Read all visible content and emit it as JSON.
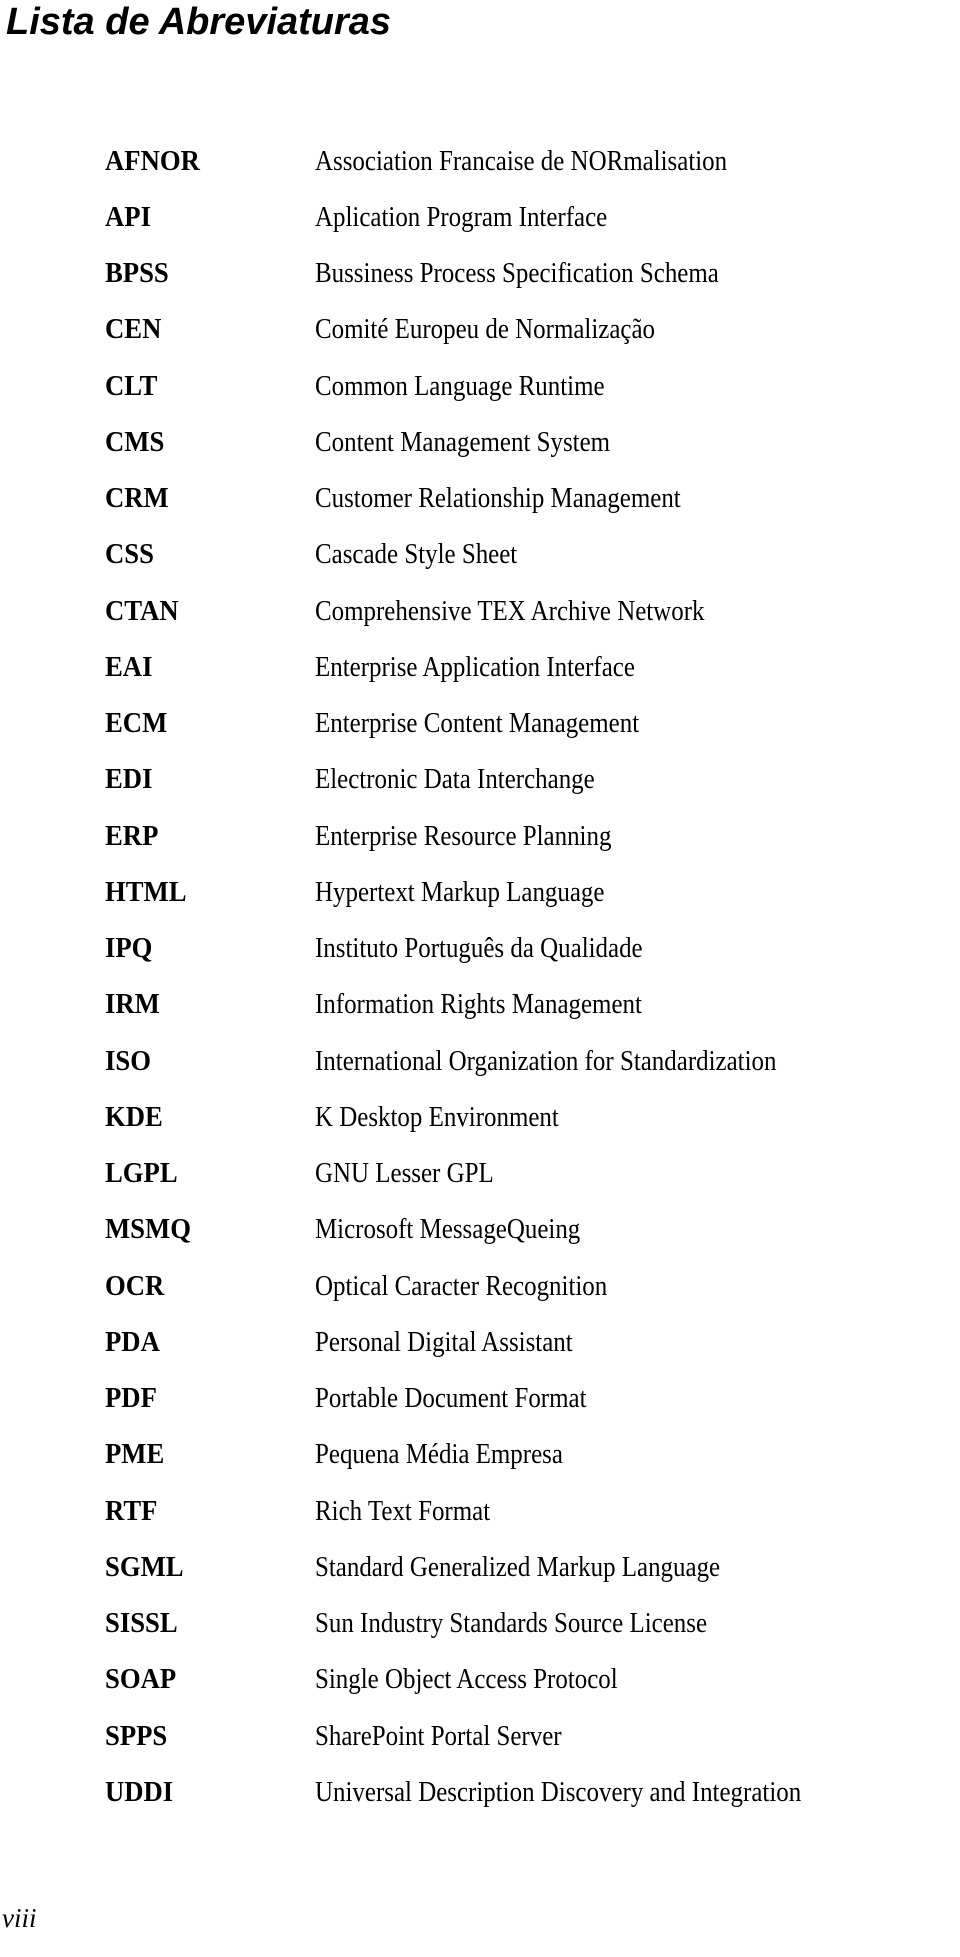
{
  "document": {
    "title": "Lista de Abreviaturas",
    "page_number": "viii",
    "abbreviations": [
      {
        "term": "AFNOR",
        "description": "Association Francaise de NORmalisation"
      },
      {
        "term": "API",
        "description": "Aplication Program Interface"
      },
      {
        "term": "BPSS",
        "description": "Bussiness Process Specification Schema"
      },
      {
        "term": "CEN",
        "description": "Comité Europeu de Normalização"
      },
      {
        "term": "CLT",
        "description": "Common Language Runtime"
      },
      {
        "term": "CMS",
        "description": "Content Management System"
      },
      {
        "term": "CRM",
        "description": "Customer Relationship Management"
      },
      {
        "term": "CSS",
        "description": "Cascade Style Sheet"
      },
      {
        "term": "CTAN",
        "description": "Comprehensive TEX Archive Network"
      },
      {
        "term": "EAI",
        "description": "Enterprise Application Interface"
      },
      {
        "term": "ECM",
        "description": "Enterprise Content Management"
      },
      {
        "term": "EDI",
        "description": "Electronic Data Interchange"
      },
      {
        "term": "ERP",
        "description": "Enterprise Resource Planning"
      },
      {
        "term": "HTML",
        "description": "Hypertext Markup Language"
      },
      {
        "term": "IPQ",
        "description": "Instituto Português da Qualidade"
      },
      {
        "term": "IRM",
        "description": "Information Rights Management"
      },
      {
        "term": "ISO",
        "description": "International Organization for Standardization"
      },
      {
        "term": "KDE",
        "description": "K Desktop Environment"
      },
      {
        "term": "LGPL",
        "description": "GNU Lesser GPL"
      },
      {
        "term": "MSMQ",
        "description": "Microsoft MessageQueing"
      },
      {
        "term": "OCR",
        "description": "Optical Caracter Recognition"
      },
      {
        "term": "PDA",
        "description": "Personal Digital Assistant"
      },
      {
        "term": "PDF",
        "description": "Portable Document Format"
      },
      {
        "term": "PME",
        "description": "Pequena Média Empresa"
      },
      {
        "term": "RTF",
        "description": "Rich Text Format"
      },
      {
        "term": "SGML",
        "description": "Standard Generalized Markup Language"
      },
      {
        "term": "SISSL",
        "description": "Sun Industry Standards Source License"
      },
      {
        "term": "SOAP",
        "description": "Single Object Access Protocol"
      },
      {
        "term": "SPPS",
        "description": "SharePoint Portal Server"
      },
      {
        "term": "UDDI",
        "description": "Universal Description Discovery and Integration"
      }
    ]
  }
}
